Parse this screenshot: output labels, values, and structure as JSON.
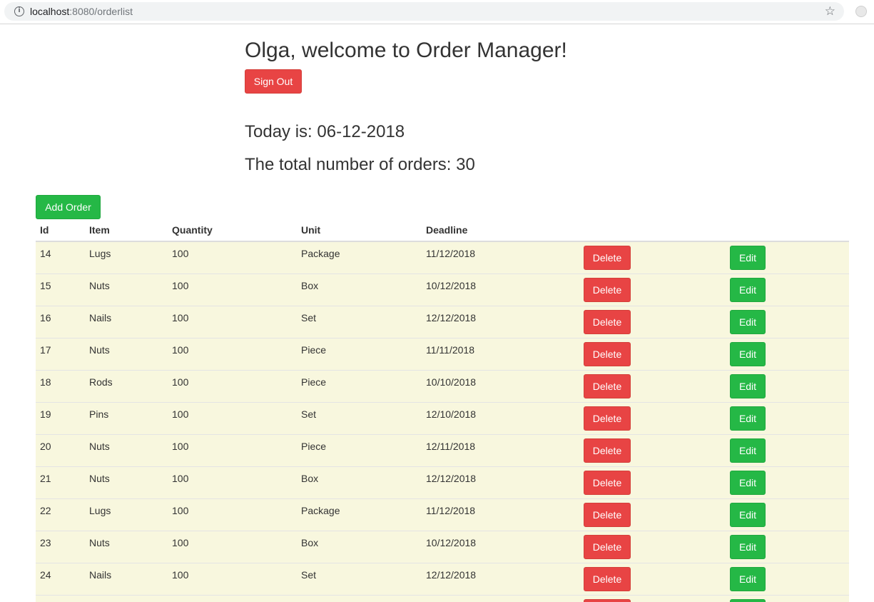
{
  "browser": {
    "url_host": "localhost",
    "url_rest": ":8080/orderlist"
  },
  "header": {
    "welcome": "Olga, welcome to Order Manager!",
    "sign_out_label": "Sign Out",
    "today": "Today is: 06-12-2018",
    "total": "The total number of orders: 30"
  },
  "add_order_label": "Add Order",
  "table": {
    "columns": [
      "Id",
      "Item",
      "Quantity",
      "Unit",
      "Deadline"
    ],
    "delete_label": "Delete",
    "edit_label": "Edit",
    "rows": [
      [
        "14",
        "Lugs",
        "100",
        "Package",
        "11/12/2018"
      ],
      [
        "15",
        "Nuts",
        "100",
        "Box",
        "10/12/2018"
      ],
      [
        "16",
        "Nails",
        "100",
        "Set",
        "12/12/2018"
      ],
      [
        "17",
        "Nuts",
        "100",
        "Piece",
        "11/11/2018"
      ],
      [
        "18",
        "Rods",
        "100",
        "Piece",
        "10/10/2018"
      ],
      [
        "19",
        "Pins",
        "100",
        "Set",
        "12/10/2018"
      ],
      [
        "20",
        "Nuts",
        "100",
        "Piece",
        "12/11/2018"
      ],
      [
        "21",
        "Nuts",
        "100",
        "Box",
        "12/12/2018"
      ],
      [
        "22",
        "Lugs",
        "100",
        "Package",
        "11/12/2018"
      ],
      [
        "23",
        "Nuts",
        "100",
        "Box",
        "10/12/2018"
      ],
      [
        "24",
        "Nails",
        "100",
        "Set",
        "12/12/2018"
      ],
      [
        "",
        "",
        "",
        "",
        ""
      ]
    ]
  },
  "colors": {
    "danger": "#e84444",
    "success": "#25b846",
    "row_bg": "#f8f7de"
  }
}
